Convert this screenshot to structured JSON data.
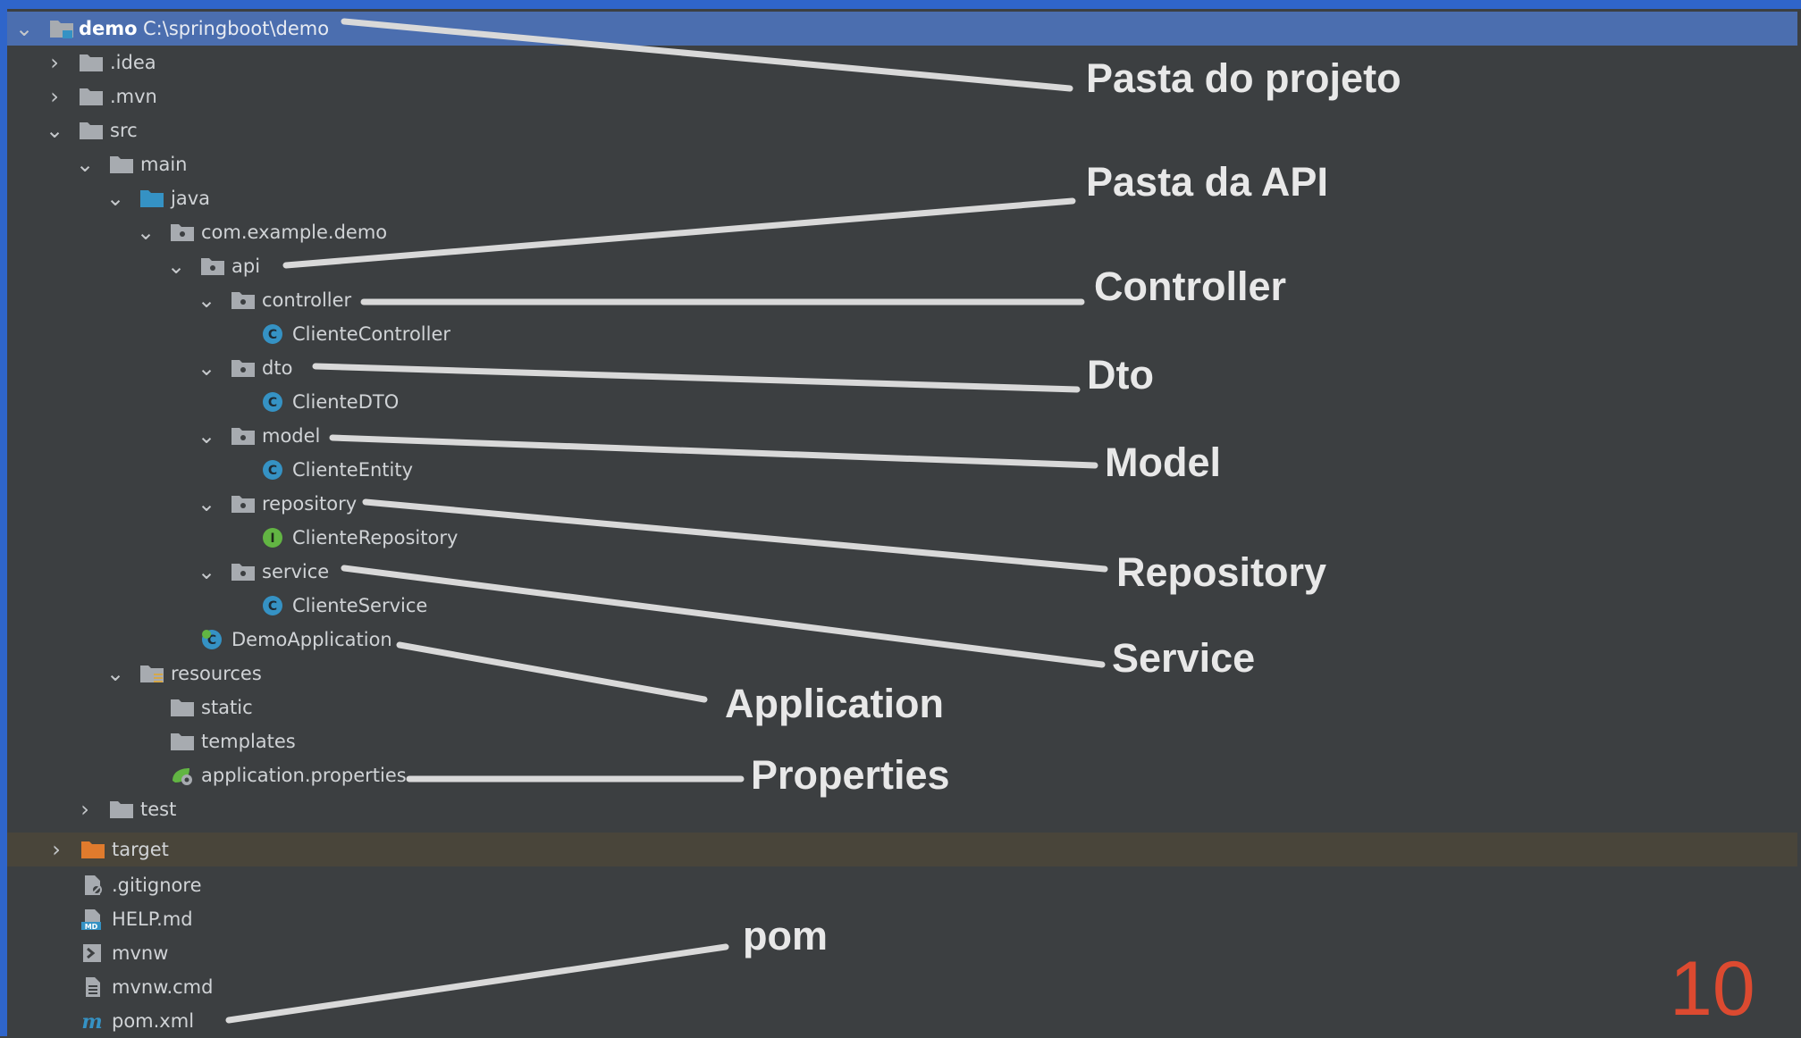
{
  "project_tree": {
    "root": {
      "label": "demo",
      "path": "C:\\springboot\\demo"
    },
    "nodes": {
      "idea": ".idea",
      "mvn": ".mvn",
      "src": "src",
      "main": "main",
      "java": "java",
      "package": "com.example.demo",
      "api": "api",
      "controller": "controller",
      "cliente_controller": "ClienteController",
      "dto": "dto",
      "cliente_dto": "ClienteDTO",
      "model": "model",
      "cliente_entity": "ClienteEntity",
      "repository": "repository",
      "cliente_repository": "ClienteRepository",
      "service": "service",
      "cliente_service": "ClienteService",
      "demo_application": "DemoApplication",
      "resources": "resources",
      "static": "static",
      "templates": "templates",
      "app_properties": "application.properties",
      "test": "test",
      "target": "target",
      "gitignore": ".gitignore",
      "help_md": "HELP.md",
      "mvnw": "mvnw",
      "mvnw_cmd": "mvnw.cmd",
      "pom_xml": "pom.xml"
    }
  },
  "annotations": {
    "project_folder": "Pasta do projeto",
    "api_folder": "Pasta da API",
    "controller": "Controller",
    "dto": "Dto",
    "model": "Model",
    "repository": "Repository",
    "service": "Service",
    "application": "Application",
    "properties": "Properties",
    "pom": "pom"
  },
  "page_number": "10",
  "colors": {
    "background": "#3c3f41",
    "selection": "#4b6eaf",
    "excluded_row": "#49453a",
    "folder": "#a7abb0",
    "source_folder": "#3592c4",
    "excluded_folder": "#e07b2d",
    "class_icon": "#3592c4",
    "interface_icon": "#62b543",
    "annotation_text": "#e8e8e8",
    "leader_line": "#d9d9d9",
    "page_number": "#dc4a30"
  },
  "icons": {
    "expanded": "chevron-down-icon",
    "collapsed": "chevron-right-icon",
    "folder": "folder-icon",
    "package": "package-icon",
    "class": "class-icon",
    "interface": "interface-icon",
    "spring_boot_app": "spring-boot-app-icon",
    "properties": "properties-file-icon",
    "gitignore": "gitignore-file-icon",
    "markdown": "markdown-file-icon",
    "shell": "shell-script-icon",
    "text_file": "text-file-icon",
    "maven": "maven-icon"
  }
}
